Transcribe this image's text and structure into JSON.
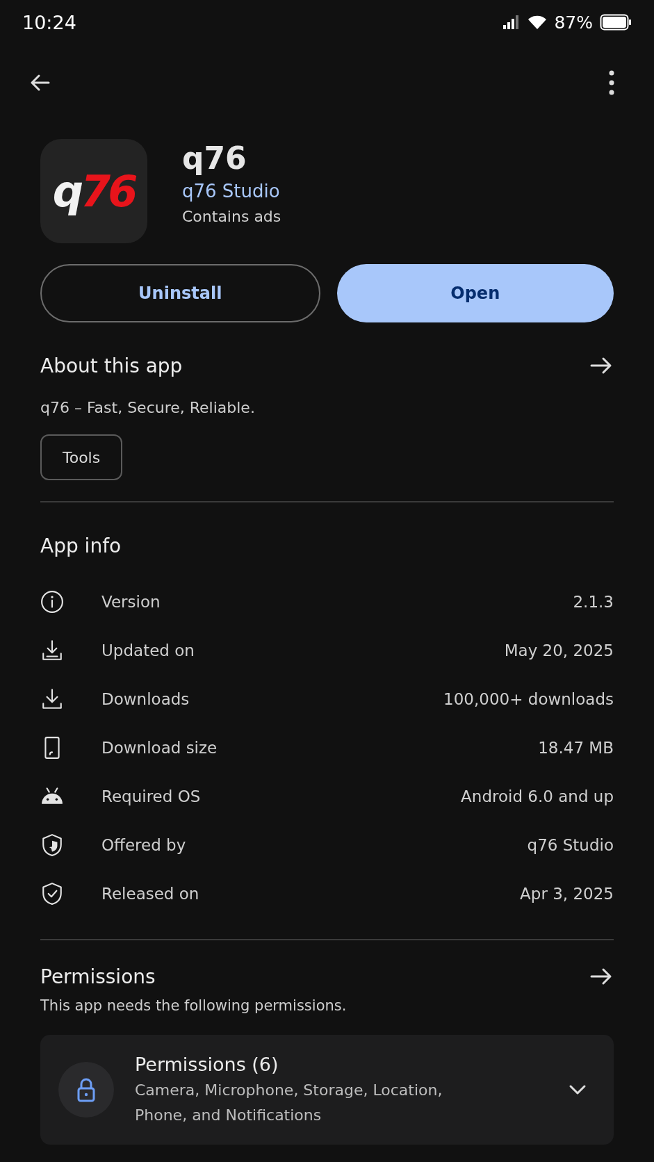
{
  "status_bar": {
    "time": "10:24",
    "battery": "87%"
  },
  "app": {
    "icon_text": [
      "q",
      "76"
    ],
    "name": "q76",
    "developer": "q76 Studio",
    "note": "Contains ads"
  },
  "buttons": [
    {
      "label": "Uninstall",
      "kind": "outline"
    },
    {
      "label": "Open",
      "kind": "filled"
    }
  ],
  "about": {
    "title": "About this app",
    "description": "q76 – Fast, Secure, Reliable.",
    "tags": [
      "Tools"
    ]
  },
  "app_info": {
    "title": "App info",
    "rows": [
      {
        "kind": "info",
        "label": "Version",
        "value": "2.1.3"
      },
      {
        "kind": "update",
        "label": "Updated on",
        "value": "May 20, 2025"
      },
      {
        "kind": "download",
        "label": "Downloads",
        "value": "100,000+ downloads"
      },
      {
        "kind": "size",
        "label": "Download size",
        "value": "18.47 MB"
      },
      {
        "kind": "android",
        "label": "Required OS",
        "value": "Android 6.0 and up"
      },
      {
        "kind": "shield",
        "label": "Offered by",
        "value": "q76 Studio"
      },
      {
        "kind": "shield-check",
        "label": "Released on",
        "value": "Apr 3, 2025"
      }
    ]
  },
  "permissions": {
    "title": "Permissions",
    "subtitle": "This app needs the following permissions.",
    "card": {
      "title": "Permissions (6)",
      "details": "Camera, Microphone, Storage, Location, Phone, and Notifications",
      "expanded": false
    }
  }
}
